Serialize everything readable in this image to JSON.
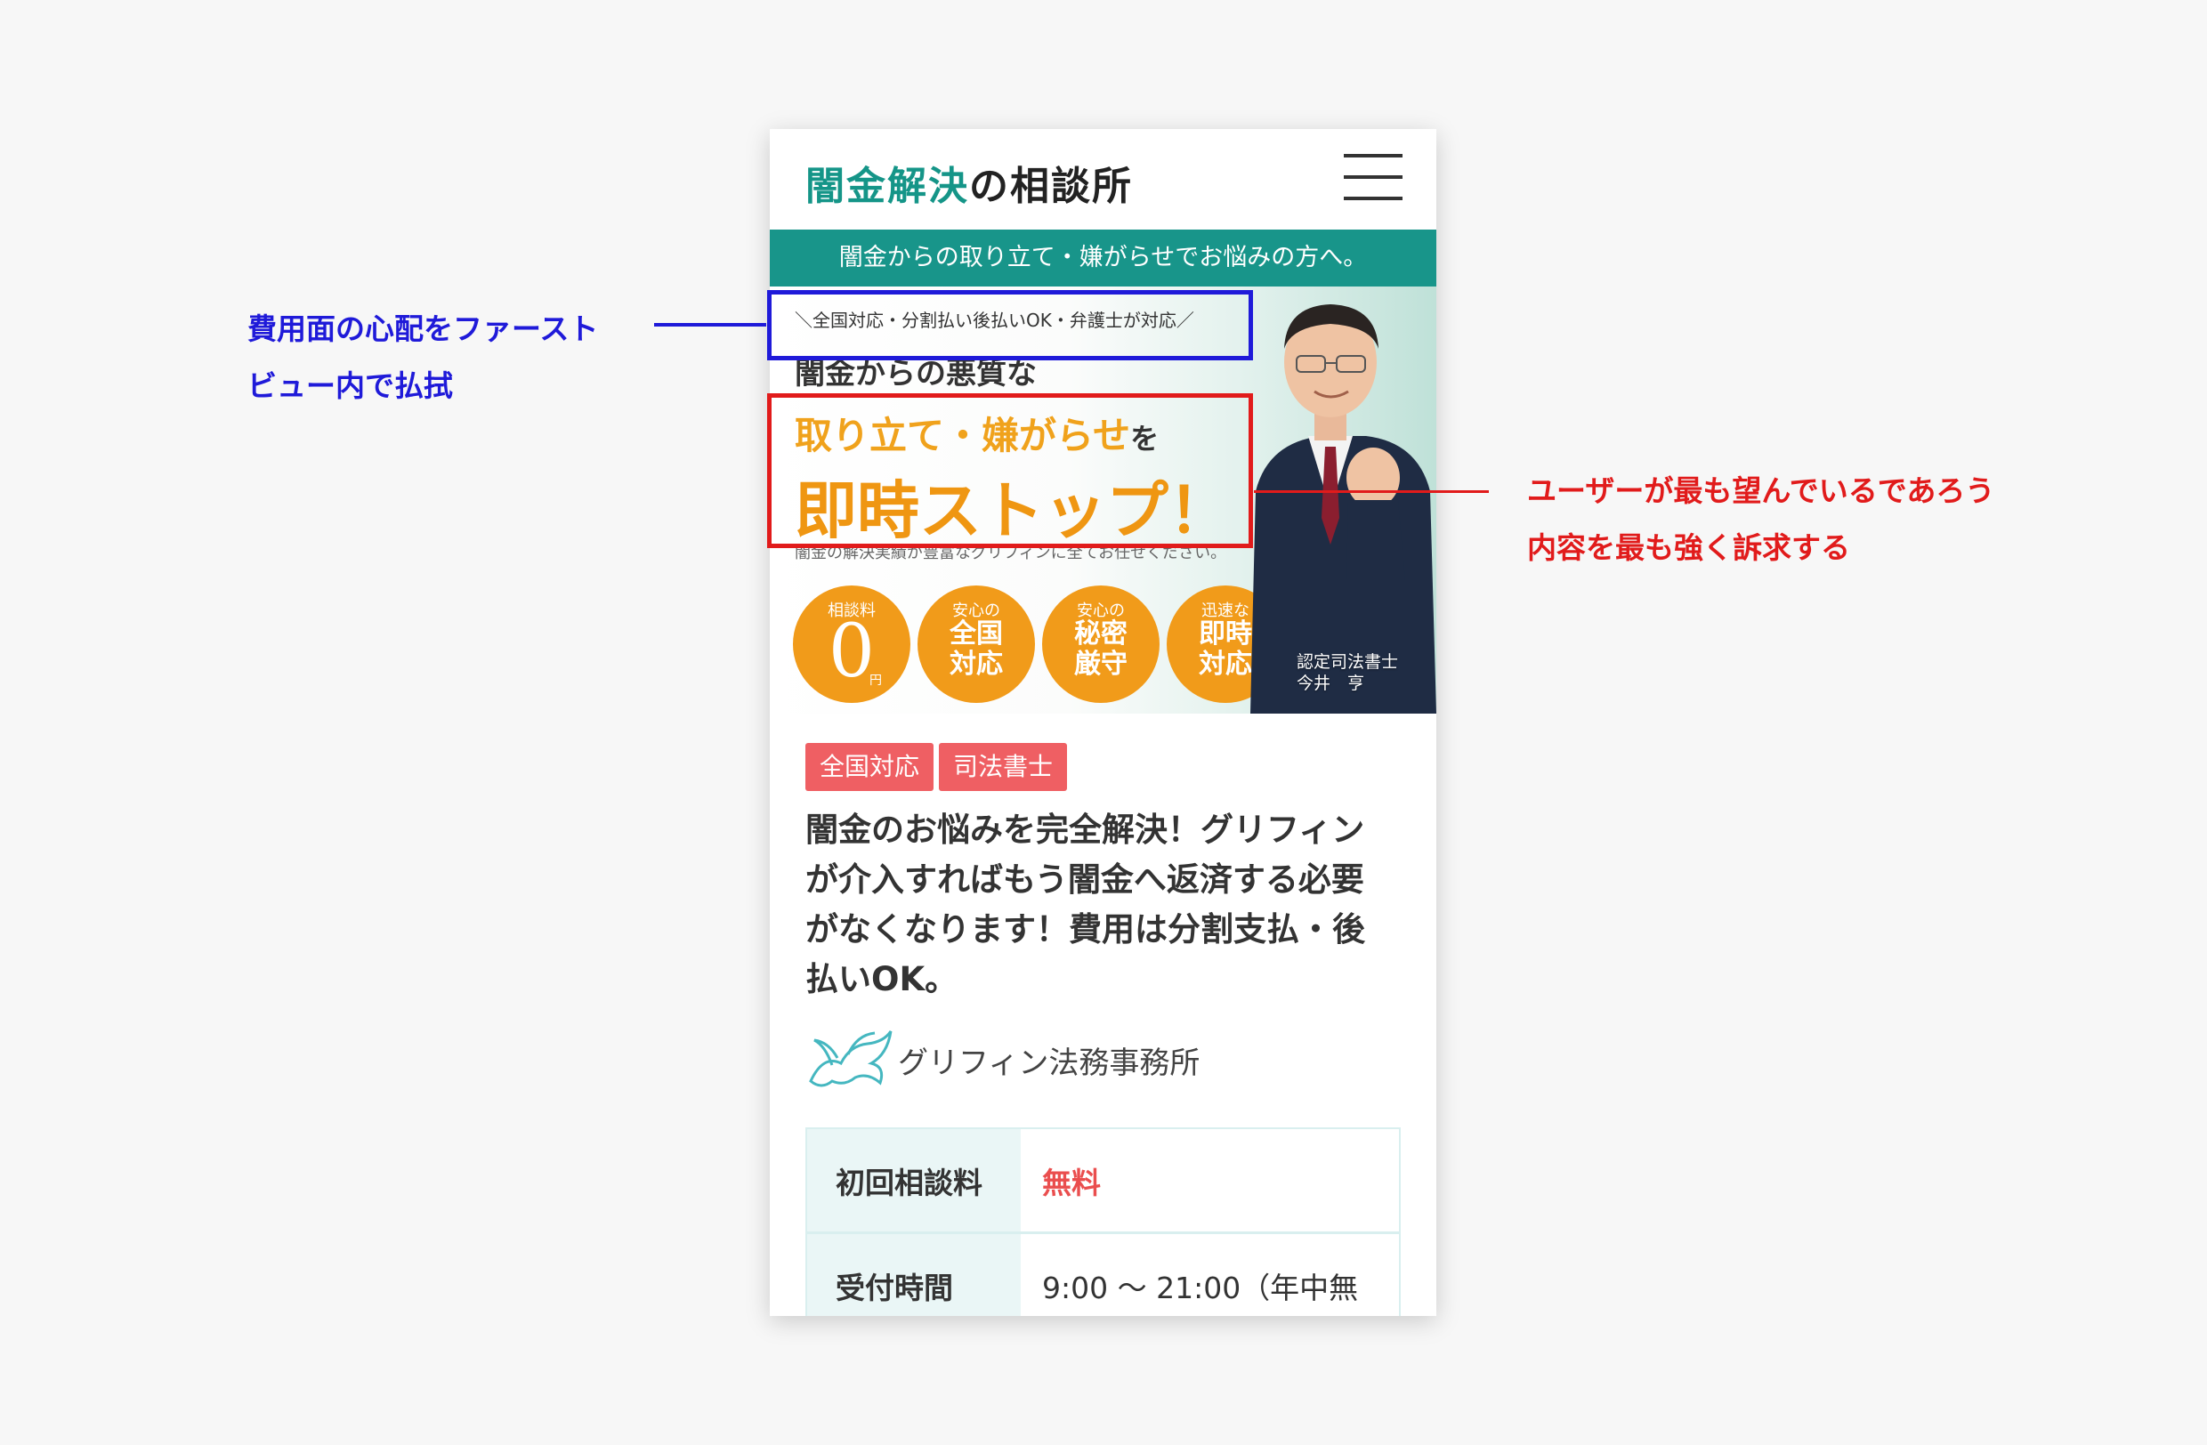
{
  "header": {
    "logo_accent": "闇金解決",
    "logo_rest": "の相談所",
    "menu_icon": "hamburger-icon"
  },
  "tagline": "闇金からの取り立て・嫌がらせでお悩みの方へ。",
  "hero": {
    "top_banner": "＼全国対応・分割払い後払いOK・弁護士が対応／",
    "line1": "闇金からの悪質な",
    "line2": "取り立て・嫌がらせ",
    "line2_suffix": "を",
    "line3": "即時ストップ！",
    "sub": "闇金の解決実績が豊富なグリフィンに全てお任せください。",
    "badges": [
      {
        "small": "相談料",
        "big": "0",
        "unit": "円"
      },
      {
        "small": "安心の",
        "big": "全国\n対応"
      },
      {
        "small": "安心の",
        "big": "秘密\n厳守"
      },
      {
        "small": "迅速な",
        "big": "即時\n対応"
      }
    ],
    "caption_title": "認定司法書士",
    "caption_name": "今井　亨"
  },
  "tags": [
    "全国対応",
    "司法書士"
  ],
  "article_title": "闇金のお悩みを完全解決！グリフィンが介入すればもう闇金へ返済する必要がなくなります！費用は分割支払・後払いOK。",
  "firm": {
    "name": "グリフィン法務事務所",
    "logo_icon": "griffin-logo-icon"
  },
  "info_table": [
    {
      "label": "初回相談料",
      "value": "無料",
      "accent": true
    },
    {
      "label": "受付時間",
      "value": "9:00 〜 21:00（年中無"
    }
  ],
  "annotations": {
    "blue_note_line1": "費用面の心配をファースト",
    "blue_note_line2": "ビュー内で払拭",
    "red_note_line1": "ユーザーが最も望んでいるであろう",
    "red_note_line2": "内容を最も強く訴求する",
    "blue_color": "#1f1ad9",
    "red_color": "#e11b1b"
  },
  "colors": {
    "brand_teal": "#159588",
    "tag_red": "#ef5f63",
    "badge_orange": "#f19b1a"
  }
}
